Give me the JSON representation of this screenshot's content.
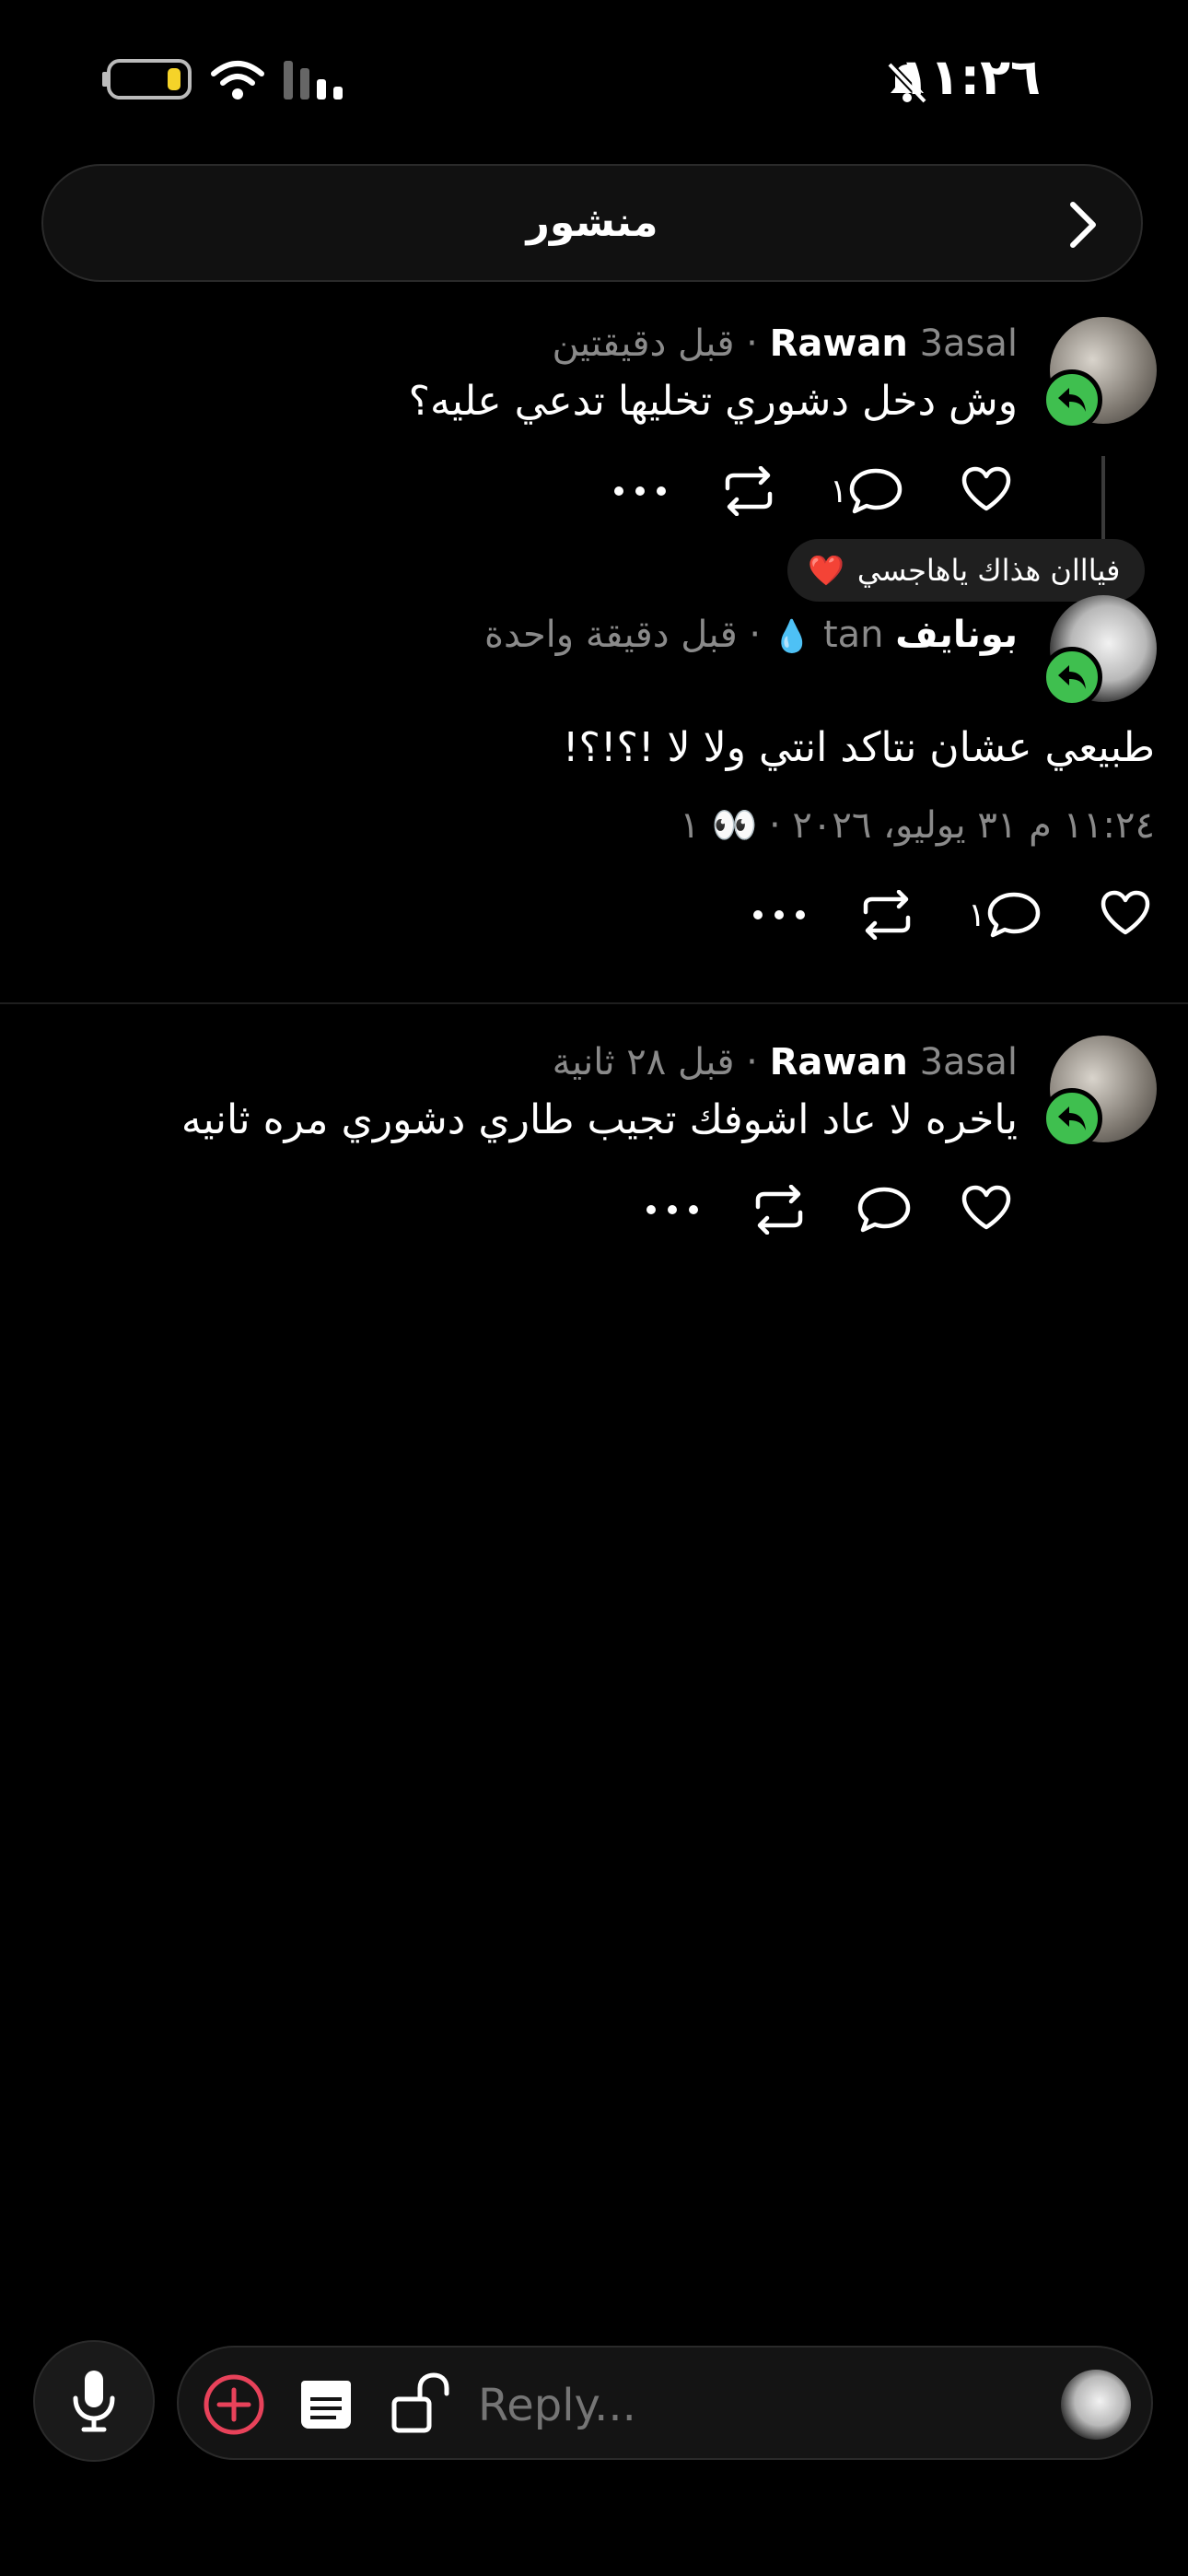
{
  "status_bar": {
    "time": "١١:٢٦"
  },
  "header": {
    "title": "منشور"
  },
  "post1": {
    "author": "Rawan",
    "handle": "3asal",
    "time": "قبل دقيقتين",
    "text": "وش دخل دشوري تخليها تدعي عليه؟",
    "reply_count": "١"
  },
  "reaction": {
    "text": "فيااان هذاك ياهاجسي",
    "emoji": "❤️"
  },
  "post2": {
    "author": "بونايف",
    "handle": "tan",
    "handle_emoji": "💧",
    "time": "قبل دقيقة واحدة",
    "text": "طبيعي عشان نتاكد انتي ولا لا !؟!؟!",
    "timestamp": "١١:٢٤ م ٣١ يوليو، ٢٠٢٦",
    "views_icon": "👀",
    "views": "١",
    "reply_count": "١"
  },
  "post3": {
    "author": "Rawan",
    "handle": "3asal",
    "time": "قبل ٢٨ ثانية",
    "text": "ياخره لا عاد اشوفك تجيب طاري دشوري مره ثانيه"
  },
  "compose": {
    "placeholder": "Reply..."
  },
  "icons": {
    "battery": "battery-icon",
    "wifi": "wifi-icon",
    "signal": "signal-icon",
    "bell_off": "bell-off-icon",
    "back": "chevron-right-icon",
    "like": "heart-icon",
    "reply": "comment-icon",
    "repost": "repost-icon",
    "more": "more-icon",
    "mic": "mic-icon",
    "add": "plus-circle-icon",
    "note": "note-icon",
    "lock": "unlock-icon"
  },
  "colors": {
    "accent_green": "#3fbf4f",
    "add_red": "#e8425a",
    "battery_yellow": "#f5d329"
  }
}
